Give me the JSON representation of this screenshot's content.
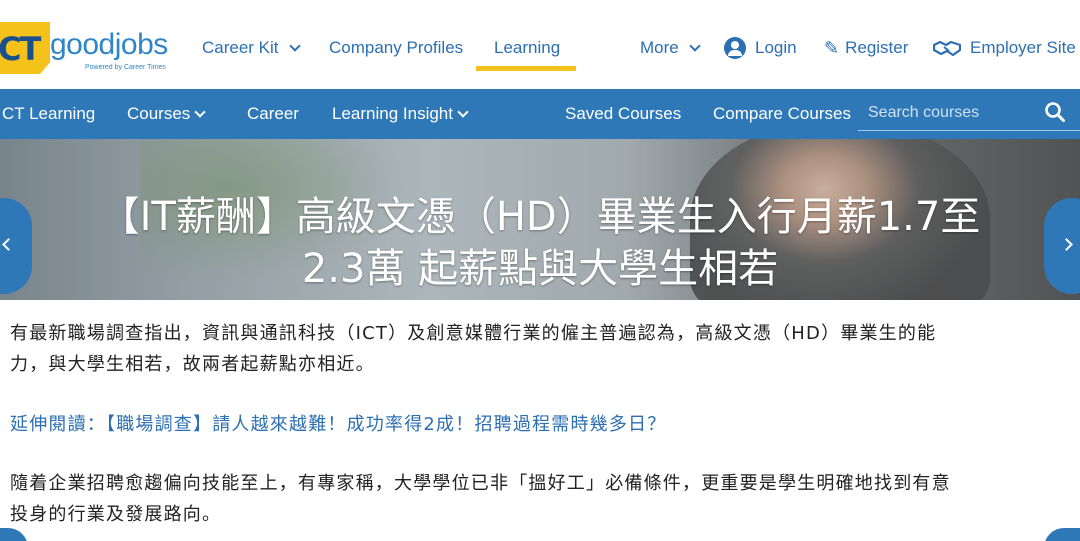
{
  "header": {
    "logo_ct": "CT",
    "logo_text": "goodjobs",
    "logo_sub": "Powered by Career Times",
    "nav": {
      "career_kit": "Career Kit",
      "company_profiles": "Company Profiles",
      "learning": "Learning",
      "more": "More",
      "login": "Login",
      "register": "Register",
      "employer_site": "Employer Site"
    }
  },
  "subnav": {
    "ct_learning": "CT Learning",
    "courses": "Courses",
    "career": "Career",
    "learning_insight": "Learning Insight",
    "saved_courses": "Saved Courses",
    "compare_courses": "Compare Courses",
    "search_placeholder": "Search courses"
  },
  "hero": {
    "title_line1": "【IT薪酬】高級文憑（HD）畢業生入行月薪1.7至",
    "title_line2": "2.3萬 起薪點與大學生相若"
  },
  "article": {
    "p1_line1": "有最新職場調查指出，資訊與通訊科技（ICT）及創意媒體行業的僱主普遍認為，高級文憑（HD）畢業生的能",
    "p1_line2": "力，與大學生相若，故兩者起薪點亦相近。",
    "p2": "延伸閱讀：【職場調查】請人越來越難！成功率得2成！招聘過程需時幾多日？",
    "p3_line1": "隨着企業招聘愈趨偏向技能至上，有專家稱，大學學位已非「搵好工」必備條件，更重要是學生明確地找到有意",
    "p3_line2": "投身的行業及發展路向。"
  },
  "colors": {
    "brand_blue": "#2e78b7",
    "nav_text": "#2d6fb3",
    "accent_yellow": "#f4c21a"
  }
}
